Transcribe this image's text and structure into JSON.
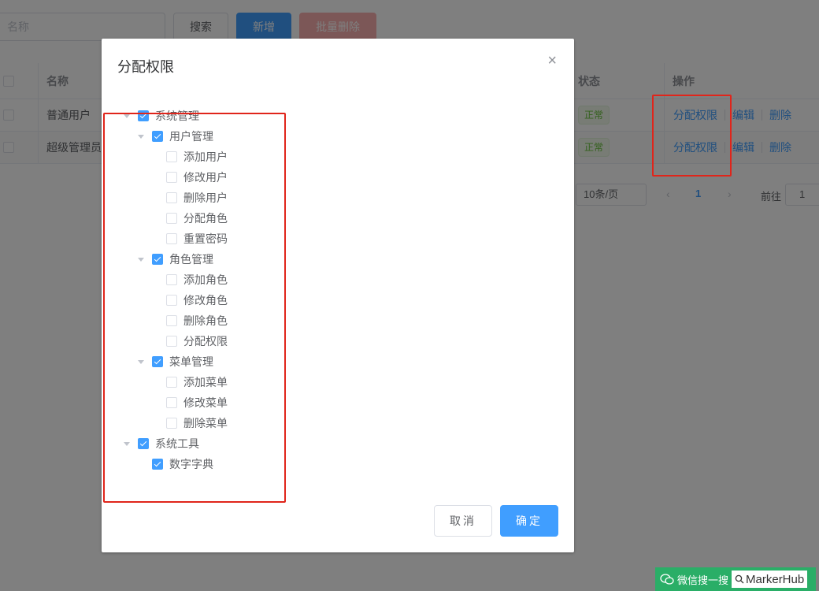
{
  "toolbar": {
    "search_placeholder": "名称",
    "search_label": "搜索",
    "add_label": "新增",
    "batch_delete_label": "批量删除"
  },
  "table": {
    "headers": {
      "name": "名称",
      "status": "状态",
      "ops": "操作"
    },
    "rows": [
      {
        "name": "普通用户",
        "status": "正常",
        "assign": "分配权限",
        "edit": "编辑",
        "delete": "删除"
      },
      {
        "name": "超级管理员",
        "status": "正常",
        "assign": "分配权限",
        "edit": "编辑",
        "delete": "删除"
      }
    ]
  },
  "pager": {
    "page_size": "10条/页",
    "current_page": "1",
    "goto_label": "前往",
    "goto_value": "1"
  },
  "dialog": {
    "title": "分配权限",
    "close_icon": "×",
    "cancel_label": "取消",
    "ok_label": "确定",
    "tree": [
      {
        "label": "系统管理",
        "checked": true,
        "children": [
          {
            "label": "用户管理",
            "checked": true,
            "children": [
              {
                "label": "添加用户",
                "checked": false
              },
              {
                "label": "修改用户",
                "checked": false
              },
              {
                "label": "删除用户",
                "checked": false
              },
              {
                "label": "分配角色",
                "checked": false
              },
              {
                "label": "重置密码",
                "checked": false
              }
            ]
          },
          {
            "label": "角色管理",
            "checked": true,
            "children": [
              {
                "label": "添加角色",
                "checked": false
              },
              {
                "label": "修改角色",
                "checked": false
              },
              {
                "label": "删除角色",
                "checked": false
              },
              {
                "label": "分配权限",
                "checked": false
              }
            ]
          },
          {
            "label": "菜单管理",
            "checked": true,
            "children": [
              {
                "label": "添加菜单",
                "checked": false
              },
              {
                "label": "修改菜单",
                "checked": false
              },
              {
                "label": "删除菜单",
                "checked": false
              }
            ]
          }
        ]
      },
      {
        "label": "系统工具",
        "checked": true,
        "children": [
          {
            "label": "数字字典",
            "checked": true
          }
        ]
      }
    ]
  },
  "watermark": {
    "text": "微信搜一搜",
    "brand": "MarkerHub"
  },
  "colors": {
    "primary": "#409eff",
    "danger": "#f56c6c",
    "success": "#67c23a",
    "annotation": "#e0251b"
  }
}
